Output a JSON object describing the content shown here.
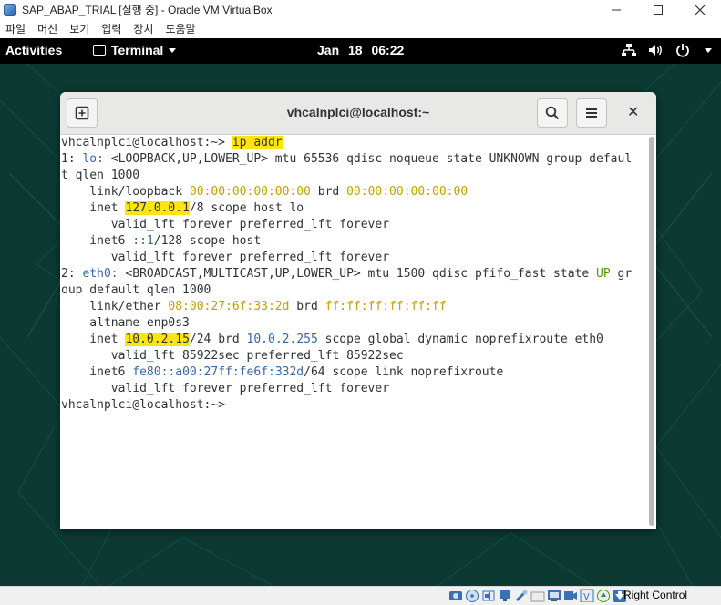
{
  "vbox": {
    "title": "SAP_ABAP_TRIAL [실행 중] - Oracle VM VirtualBox",
    "menus": [
      "파일",
      "머신",
      "보기",
      "입력",
      "장치",
      "도움말"
    ],
    "minimize": "—",
    "maximize": "☐",
    "close": "✕",
    "host_key": "Right Control"
  },
  "gnome": {
    "activities": "Activities",
    "app_name": "Terminal",
    "clock": "Jan 18  06:22"
  },
  "terminal": {
    "title": "vhcalnplci@localhost:~",
    "close": "✕",
    "lines": {
      "l1_prompt": "vhcalnplci@localhost:~> ",
      "l1_cmd": "ip addr",
      "l2_a": "1: ",
      "l2_if": "lo:",
      "l2_b": " <LOOPBACK,UP,LOWER_UP> mtu 65536 qdisc noqueue state UNKNOWN group defaul",
      "l3": "t qlen 1000",
      "l4_a": "    link/loopback ",
      "l4_mac": "00:00:00:00:00:00",
      "l4_b": " brd ",
      "l4_brd": "00:00:00:00:00:00",
      "l5_a": "    inet ",
      "l5_ip": "127.0.0.1",
      "l5_b": "/8 scope host lo",
      "l6": "       valid_lft forever preferred_lft forever",
      "l7_a": "    inet6 ",
      "l7_ip": "::1",
      "l7_b": "/128 scope host",
      "l8": "       valid_lft forever preferred_lft forever",
      "l9_a": "2: ",
      "l9_if": "eth0:",
      "l9_b": " <BROADCAST,MULTICAST,UP,LOWER_UP> mtu 1500 qdisc pfifo_fast state ",
      "l9_up": "UP",
      "l9_c": " gr",
      "l10": "oup default qlen 1000",
      "l11_a": "    link/ether ",
      "l11_mac": "08:00:27:6f:33:2d",
      "l11_b": " brd ",
      "l11_brd": "ff:ff:ff:ff:ff:ff",
      "l12": "    altname enp0s3",
      "l13_a": "    inet ",
      "l13_ip": "10.0.2.15",
      "l13_b": "/24 brd ",
      "l13_brd": "10.0.2.255",
      "l13_c": " scope global dynamic noprefixroute eth0",
      "l14": "       valid_lft 85922sec preferred_lft 85922sec",
      "l15_a": "    inet6 ",
      "l15_ip": "fe80::a00:27ff:fe6f:332d",
      "l15_b": "/64 scope link noprefixroute",
      "l16": "       valid_lft forever preferred_lft forever",
      "l17_prompt": "vhcalnplci@localhost:~> "
    }
  },
  "colors": {
    "ip_highlight": "#ffe510",
    "green": "#4e9a06",
    "blue": "#3465a4",
    "yellow": "#c4a000"
  }
}
